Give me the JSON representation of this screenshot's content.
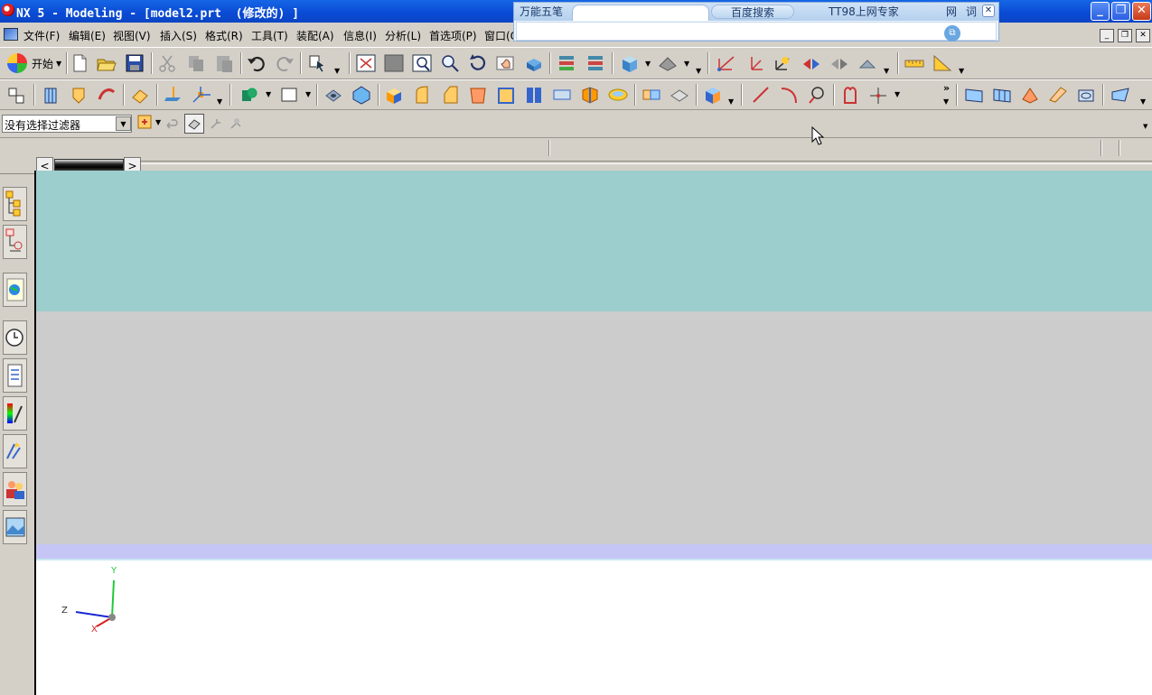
{
  "window": {
    "title": "NX 5 - Modeling - [model2.prt  (修改的) ]",
    "controls": [
      "_",
      "❐",
      "✕"
    ]
  },
  "ime": {
    "tabs": [
      "万能五笔",
      "百度搜索",
      "TT98上网专家",
      "网",
      "词",
      "✕"
    ]
  },
  "menubar": {
    "items": [
      "文件(F)",
      "编辑(E)",
      "视图(V)",
      "插入(S)",
      "格式(R)",
      "工具(T)",
      "装配(A)",
      "信息(I)",
      "分析(L)",
      "首选项(P)",
      "窗口(O)"
    ]
  },
  "toolbar1": {
    "start_label": "开始"
  },
  "selection": {
    "filter_value": "没有选择过滤器"
  },
  "triad": {
    "x": "X",
    "y": "Y",
    "z": "Z"
  },
  "colors": {
    "titlebar": "#0a4ad4",
    "band_teal": "#9dcece",
    "band_gray": "#cccccc",
    "band_lavender": "#c6c6f6",
    "band_white": "#ffffff"
  }
}
